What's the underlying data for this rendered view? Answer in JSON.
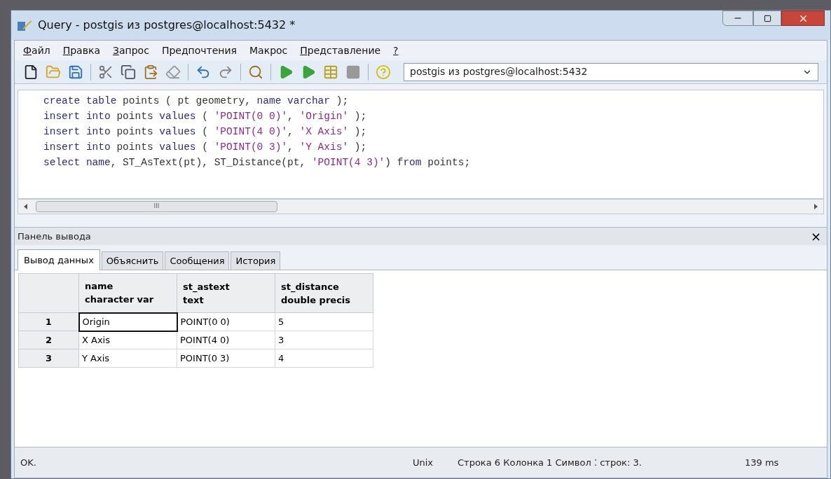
{
  "window": {
    "title": "Query - postgis из postgres@localhost:5432 *"
  },
  "menu": [
    {
      "label": "Файл",
      "underlined": true
    },
    {
      "label": "Правка",
      "underlined": true
    },
    {
      "label": "Запрос",
      "underlined": true
    },
    {
      "label": "Предпочтения",
      "underlined": false
    },
    {
      "label": "Макрос",
      "underlined": false
    },
    {
      "label": "Представление",
      "underlined": true
    },
    {
      "label": "?",
      "underlined": true
    }
  ],
  "toolbar": {
    "tools": [
      {
        "kind": "new"
      },
      {
        "kind": "open"
      },
      {
        "kind": "save"
      },
      {
        "kind": "sep"
      },
      {
        "kind": "cut"
      },
      {
        "kind": "copy"
      },
      {
        "kind": "paste"
      },
      {
        "kind": "clear"
      },
      {
        "kind": "sep"
      },
      {
        "kind": "undo"
      },
      {
        "kind": "redo"
      },
      {
        "kind": "sep"
      },
      {
        "kind": "find"
      },
      {
        "kind": "sep"
      },
      {
        "kind": "run"
      },
      {
        "kind": "run-file"
      },
      {
        "kind": "explain"
      },
      {
        "kind": "stop"
      },
      {
        "kind": "sep"
      },
      {
        "kind": "help"
      }
    ],
    "connection": "postgis из postgres@localhost:5432"
  },
  "editor": {
    "lines": [
      [
        {
          "kind": "kw",
          "text": "create table"
        },
        {
          "kind": "plain",
          "text": " points ( pt geometry, "
        },
        {
          "kind": "kw",
          "text": "name varchar"
        },
        {
          "kind": "plain",
          "text": " );"
        }
      ],
      [
        {
          "kind": "kw",
          "text": "insert into"
        },
        {
          "kind": "plain",
          "text": " points "
        },
        {
          "kind": "kw",
          "text": "values"
        },
        {
          "kind": "plain",
          "text": " ( "
        },
        {
          "kind": "str",
          "text": "'POINT(0 0)'"
        },
        {
          "kind": "plain",
          "text": ", "
        },
        {
          "kind": "str",
          "text": "'Origin'"
        },
        {
          "kind": "plain",
          "text": " );"
        }
      ],
      [
        {
          "kind": "kw",
          "text": "insert into"
        },
        {
          "kind": "plain",
          "text": " points "
        },
        {
          "kind": "kw",
          "text": "values"
        },
        {
          "kind": "plain",
          "text": " ( "
        },
        {
          "kind": "str",
          "text": "'POINT(4 0)'"
        },
        {
          "kind": "plain",
          "text": ", "
        },
        {
          "kind": "str",
          "text": "'X Axis'"
        },
        {
          "kind": "plain",
          "text": " );"
        }
      ],
      [
        {
          "kind": "kw",
          "text": "insert into"
        },
        {
          "kind": "plain",
          "text": " points "
        },
        {
          "kind": "kw",
          "text": "values"
        },
        {
          "kind": "plain",
          "text": " ( "
        },
        {
          "kind": "str",
          "text": "'POINT(0 3)'"
        },
        {
          "kind": "plain",
          "text": ", "
        },
        {
          "kind": "str",
          "text": "'Y Axis'"
        },
        {
          "kind": "plain",
          "text": " );"
        }
      ],
      [
        {
          "kind": "kw",
          "text": "select name"
        },
        {
          "kind": "plain",
          "text": ", ST_AsText(pt), ST_Distance(pt, "
        },
        {
          "kind": "str",
          "text": "'POINT(4 3)'"
        },
        {
          "kind": "plain",
          "text": ") "
        },
        {
          "kind": "kw",
          "text": "from"
        },
        {
          "kind": "plain",
          "text": " points;"
        }
      ]
    ],
    "scroll_grip": "III"
  },
  "output": {
    "title": "Панель вывода",
    "close": "×",
    "tabs": [
      {
        "label": "Вывод данных",
        "selected": true
      },
      {
        "label": "Объяснить",
        "selected": false
      },
      {
        "label": "Сообщения",
        "selected": false
      },
      {
        "label": "История",
        "selected": false
      }
    ],
    "table": {
      "columns": [
        {
          "name": "name",
          "type": "character var"
        },
        {
          "name": "st_astext",
          "type": "text"
        },
        {
          "name": "st_distance",
          "type": "double precis"
        }
      ],
      "rows": [
        {
          "index": "1",
          "cells": [
            "Origin",
            "POINT(0 0)",
            "5"
          ],
          "focused": true
        },
        {
          "index": "2",
          "cells": [
            "X Axis",
            "POINT(4 0)",
            "3"
          ],
          "focused": false
        },
        {
          "index": "3",
          "cells": [
            "Y Axis",
            "POINT(0 3)",
            "4"
          ],
          "focused": false
        }
      ]
    }
  },
  "status_bar": {
    "message": "OK.",
    "line_ending": "Unix",
    "position": "Строка 6 Колонка 1 Символ ⁚ строк: 3.",
    "time": "139 ms"
  }
}
